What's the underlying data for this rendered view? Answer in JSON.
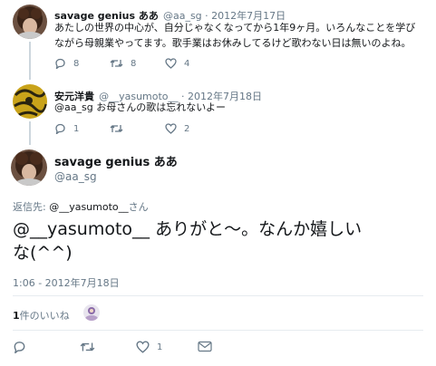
{
  "tweet1": {
    "display_name": "savage genius ああ",
    "handle_date": "@aa_sg · 2012年7月17日",
    "text_line1": "あたしの世界の中心が、自分じゃなくなってから1年9ヶ月。いろんなことを学び",
    "text_line2": "ながら母親業やってます。歌手業はお休みしてるけど歌わない日は無いのよね。",
    "reply_count": "8",
    "retweet_count": "8",
    "like_count": "4"
  },
  "tweet2": {
    "display_name": "安元洋貴",
    "handle_date": "@__yasumoto__ · 2012年7月18日",
    "text": "@aa_sg お母さんの歌は忘れないよー",
    "reply_count": "1",
    "retweet_count": "",
    "like_count": "2"
  },
  "main": {
    "display_name": "savage genius ああ",
    "handle": "@aa_sg",
    "reply_to_label": "返信先: ",
    "reply_to_handle": "@__yasumoto__",
    "reply_to_suffix": "さん",
    "text_line1": "@__yasumoto__ ありがと〜。なんか嬉しい",
    "text_line2": "な(^^)",
    "timestamp": "1:06 - 2012年7月18日",
    "likes_count": "1",
    "likes_label": "件のいいね",
    "reply_count": "",
    "retweet_count": "",
    "like_count": "1"
  },
  "colors": {
    "text": "#14171a",
    "muted": "#657786",
    "link": "#1da1f2",
    "divider": "#e6ecf0"
  }
}
